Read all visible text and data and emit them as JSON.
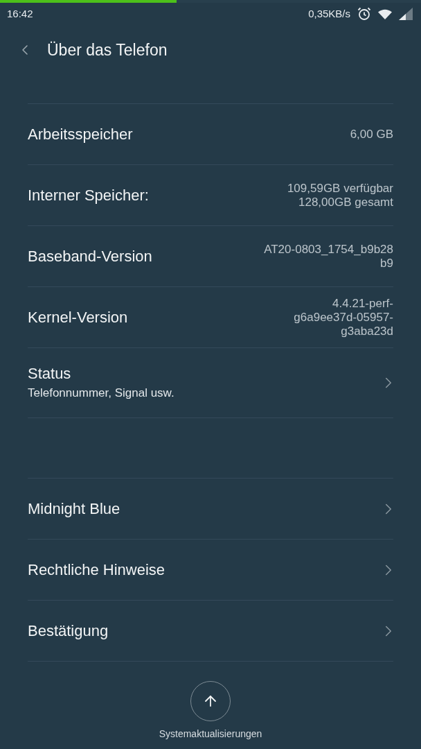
{
  "progress": {
    "level": 0.42
  },
  "status_bar": {
    "time": "16:42",
    "network_speed": "0,35KB/s"
  },
  "header": {
    "title": "Über das Telefon"
  },
  "info_rows": [
    {
      "label": "Arbeitsspeicher",
      "lines": [
        "6,00 GB"
      ]
    },
    {
      "label": "Interner Speicher:",
      "lines": [
        "109,59GB verfügbar",
        "128,00GB gesamt"
      ]
    },
    {
      "label": "Baseband-Version",
      "lines": [
        "AT20-0803_1754_b9b28",
        "b9"
      ]
    },
    {
      "label": "Kernel-Version",
      "lines": [
        "4.4.21-perf-",
        "g6a9ee37d-05957-",
        "g3aba23d"
      ]
    }
  ],
  "status_row": {
    "title": "Status",
    "subtitle": "Telefonnummer, Signal usw."
  },
  "nav_rows": [
    {
      "label": "Midnight Blue"
    },
    {
      "label": "Rechtliche Hinweise"
    },
    {
      "label": "Bestätigung"
    }
  ],
  "update_button": {
    "label": "Systemaktualisierungen"
  }
}
